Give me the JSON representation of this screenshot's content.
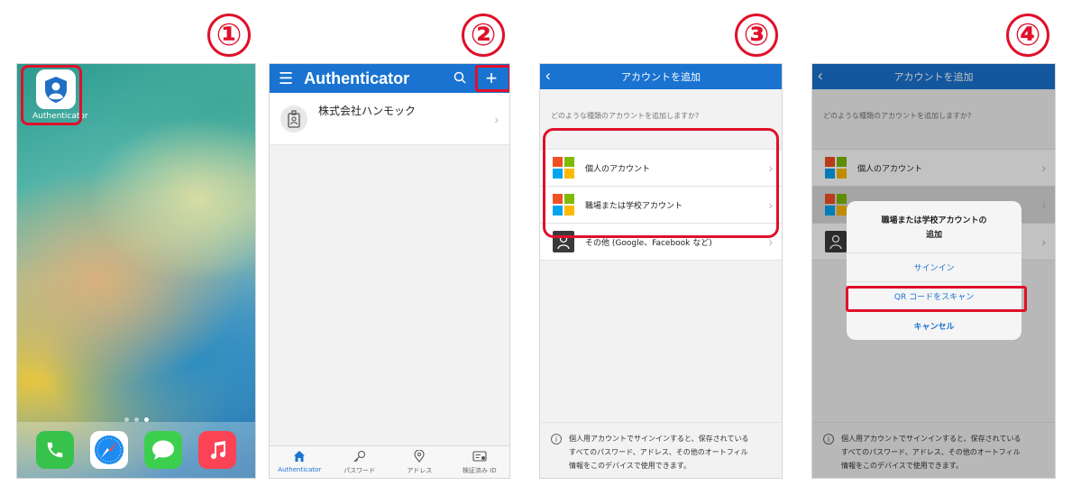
{
  "steps": [
    "①",
    "②",
    "③",
    "④"
  ],
  "home": {
    "app_label": "Authenticator",
    "dock_apps": [
      "phone-icon",
      "safari-icon",
      "messages-icon",
      "music-icon"
    ]
  },
  "authenticator": {
    "title": "Authenticator",
    "account_name": "株式会社ハンモック",
    "tabs": [
      "Authenticator",
      "パスワード",
      "アドレス",
      "検証済み ID"
    ]
  },
  "add_account": {
    "title": "アカウントを追加",
    "question": "どのような種類のアカウントを追加しますか?",
    "options": [
      "個人のアカウント",
      "職場または学校アカウント",
      "その他 (Google、Facebook など)"
    ],
    "footer": [
      "個人用アカウントでサインインすると、保存されている",
      "すべてのパスワード、アドレス、その他のオートフィル",
      "情報をこのデバイスで使用できます。"
    ]
  },
  "sheet": {
    "title_line1": "職場または学校アカウントの",
    "title_line2": "追加",
    "sign_in": "サインイン",
    "scan_qr": "QR コードをスキャン",
    "cancel": "キャンセル"
  },
  "colors": {
    "accent": "#1a73d1",
    "highlight": "#e0102a"
  }
}
